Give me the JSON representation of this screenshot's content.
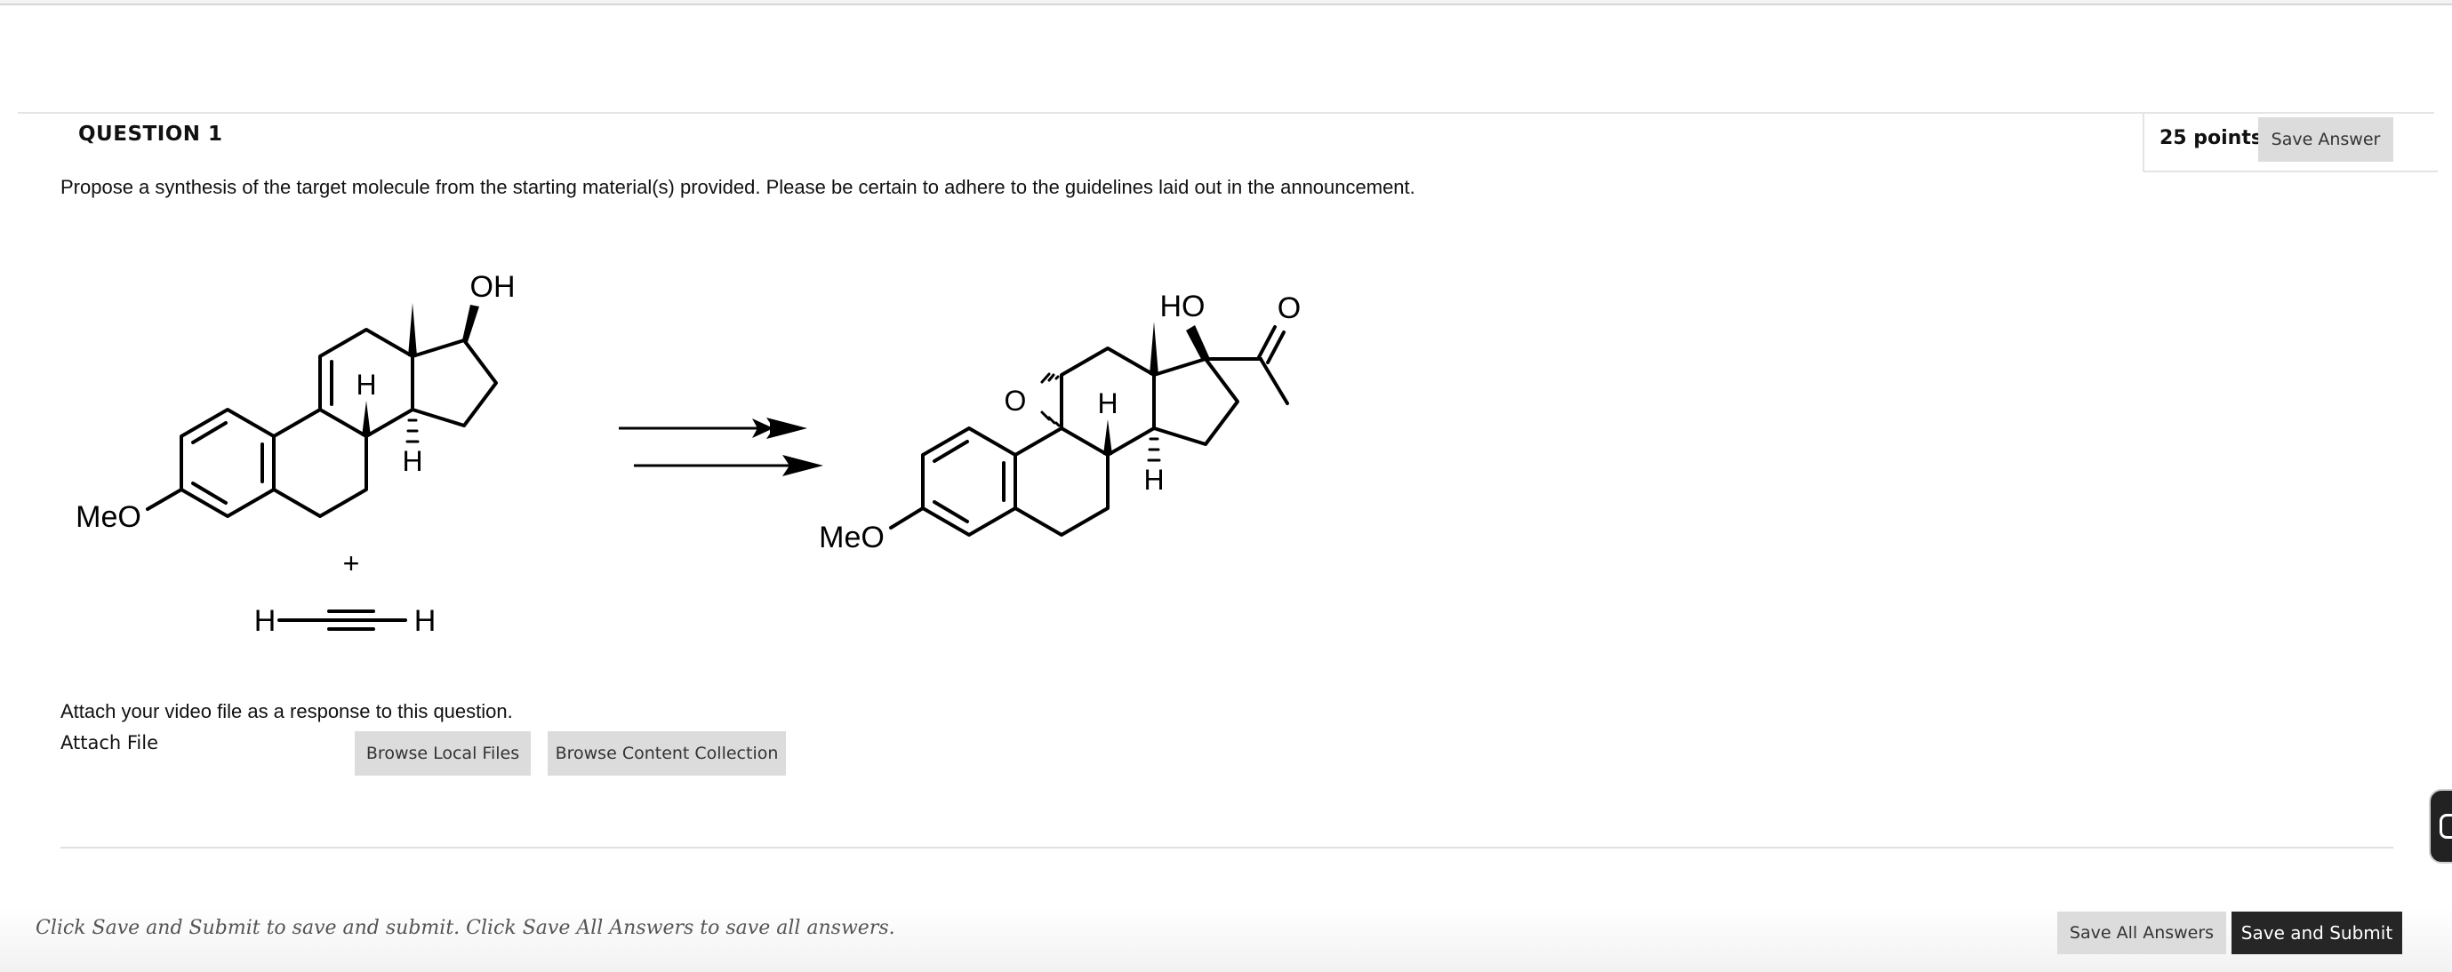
{
  "question": {
    "title": "QUESTION 1",
    "points": "25 points",
    "save_answer_label": "Save Answer",
    "prompt": "Propose a synthesis of the target molecule from the starting material(s) provided. Please be certain to adhere to the guidelines laid out in the announcement."
  },
  "scheme": {
    "start_oh": "OH",
    "start_h_upper": "H",
    "start_h_lower": "H",
    "start_meo": "MeO",
    "plus": "+",
    "acetylene_left_h": "H",
    "acetylene_right_h": "H",
    "target_ho": "HO",
    "target_ketone_o": "O",
    "target_epoxide_o": "O",
    "target_h_upper": "H",
    "target_h_lower": "H",
    "target_meo": "MeO"
  },
  "attach": {
    "prompt": "Attach your video file as a response to this question.",
    "label": "Attach File",
    "browse_local_label": "Browse Local Files",
    "browse_content_label": "Browse Content Collection"
  },
  "footer": {
    "note": "Click Save and Submit to save and submit. Click Save All Answers to save all answers.",
    "save_all_label": "Save All Answers",
    "save_submit_label": "Save and Submit"
  }
}
